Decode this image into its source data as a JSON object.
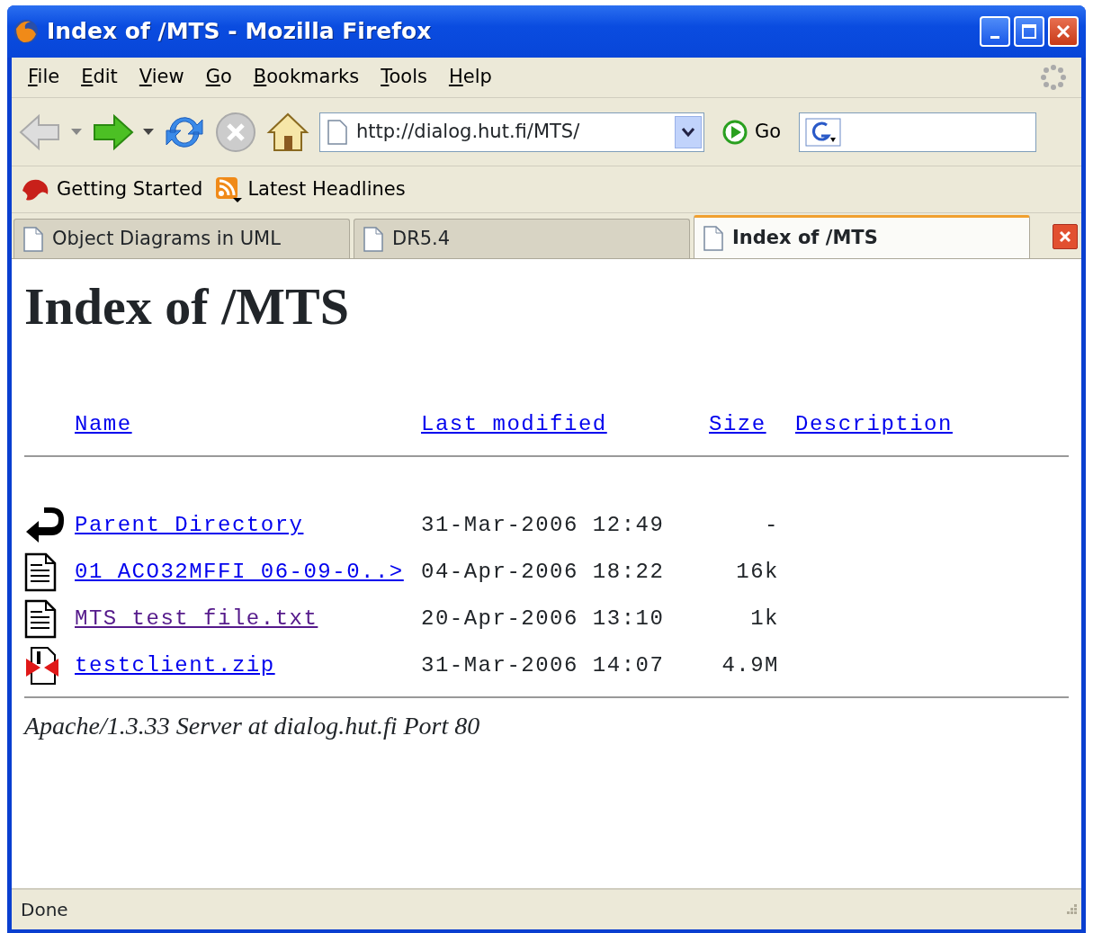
{
  "window": {
    "title": "Index of /MTS - Mozilla Firefox"
  },
  "menu": [
    "File",
    "Edit",
    "View",
    "Go",
    "Bookmarks",
    "Tools",
    "Help"
  ],
  "toolbar": {
    "url": "http://dialog.hut.fi/MTS/",
    "go": "Go"
  },
  "bookmarks": [
    {
      "label": "Getting Started",
      "kind": "start"
    },
    {
      "label": "Latest Headlines",
      "kind": "feed"
    }
  ],
  "tabs": [
    {
      "label": "Object Diagrams in UML",
      "selected": false
    },
    {
      "label": "DR5.4",
      "selected": false
    },
    {
      "label": "Index of /MTS",
      "selected": true
    }
  ],
  "page": {
    "heading": "Index of /MTS",
    "columns": [
      "Name",
      "Last modified",
      "Size",
      "Description"
    ],
    "rows": [
      {
        "kind": "back",
        "name": "Parent Directory",
        "modified": "31-Mar-2006 12:49",
        "size": "-",
        "visited": false
      },
      {
        "kind": "text",
        "name": "01 ACO32MFFI 06-09-0..>",
        "modified": "04-Apr-2006 18:22",
        "size": "16k",
        "visited": false
      },
      {
        "kind": "text",
        "name": "MTS test file.txt",
        "modified": "20-Apr-2006 13:10",
        "size": "1k",
        "visited": true
      },
      {
        "kind": "zip",
        "name": "testclient.zip",
        "modified": "31-Mar-2006 14:07",
        "size": "4.9M",
        "visited": false
      }
    ],
    "footer": "Apache/1.3.33 Server at dialog.hut.fi Port 80"
  },
  "status_bar": "Done"
}
